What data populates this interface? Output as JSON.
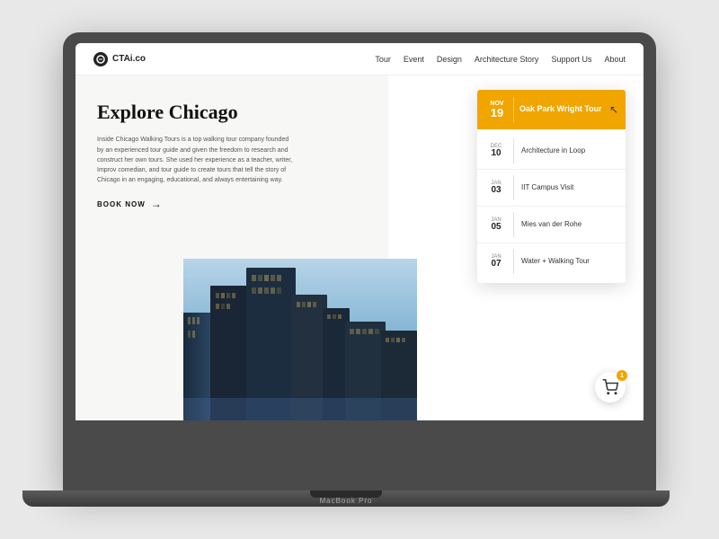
{
  "laptop": {
    "label": "MacBook Pro"
  },
  "site": {
    "logo_text": "CTAi.co",
    "nav_links": [
      {
        "label": "Tour"
      },
      {
        "label": "Event"
      },
      {
        "label": "Design"
      },
      {
        "label": "Architecture Story"
      },
      {
        "label": "Support Us"
      },
      {
        "label": "About"
      }
    ]
  },
  "hero": {
    "title": "Explore Chicago",
    "description": "Inside Chicago Walking Tours is a top walking tour company founded by an experienced tour guide and given the freedom to research and construct her own tours. She used her experience as a teacher, writer, Improv comedian, and tour guide to create tours that tell the story of Chicago in an engaging, educational, and always entertaining way.",
    "cta_label": "BOOK NOW"
  },
  "events": {
    "featured": {
      "month": "Nov",
      "day": "19",
      "title": "Oak Park Wright Tour"
    },
    "list": [
      {
        "month": "Dec",
        "day": "10",
        "title": "Architecture in Loop"
      },
      {
        "month": "Jan",
        "day": "03",
        "title": "IIT Campus Visit"
      },
      {
        "month": "Jan",
        "day": "05",
        "title": "Mies van der Rohe"
      },
      {
        "month": "Jan",
        "day": "07",
        "title": "Water + Walking Tour"
      }
    ]
  },
  "cart": {
    "badge_count": "1"
  },
  "colors": {
    "accent": "#f0a500",
    "text_dark": "#111",
    "text_mid": "#555",
    "bg_light": "#f7f7f5"
  }
}
